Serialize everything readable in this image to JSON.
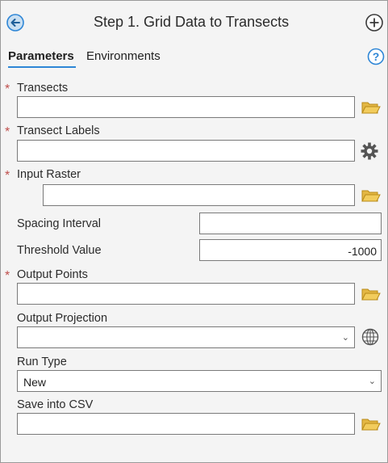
{
  "header": {
    "title": "Step 1. Grid Data to Transects"
  },
  "tabs": [
    {
      "label": "Parameters",
      "active": true
    },
    {
      "label": "Environments",
      "active": false
    }
  ],
  "params": {
    "transects": {
      "label": "Transects",
      "required": true,
      "value": ""
    },
    "transect_labels": {
      "label": "Transect Labels",
      "required": true,
      "value": ""
    },
    "input_raster": {
      "label": "Input Raster",
      "required": true,
      "value": ""
    },
    "spacing_interval": {
      "label": "Spacing Interval",
      "value": ""
    },
    "threshold_value": {
      "label": "Threshold Value",
      "value": "-1000"
    },
    "output_points": {
      "label": "Output Points",
      "required": true,
      "value": ""
    },
    "output_projection": {
      "label": "Output Projection",
      "value": ""
    },
    "run_type": {
      "label": "Run Type",
      "value": "New"
    },
    "save_csv": {
      "label": "Save into CSV",
      "value": ""
    }
  },
  "required_marker": "*",
  "colors": {
    "accent": "#2e86d6",
    "required": "#c0504d",
    "folder": "#e3b744"
  }
}
